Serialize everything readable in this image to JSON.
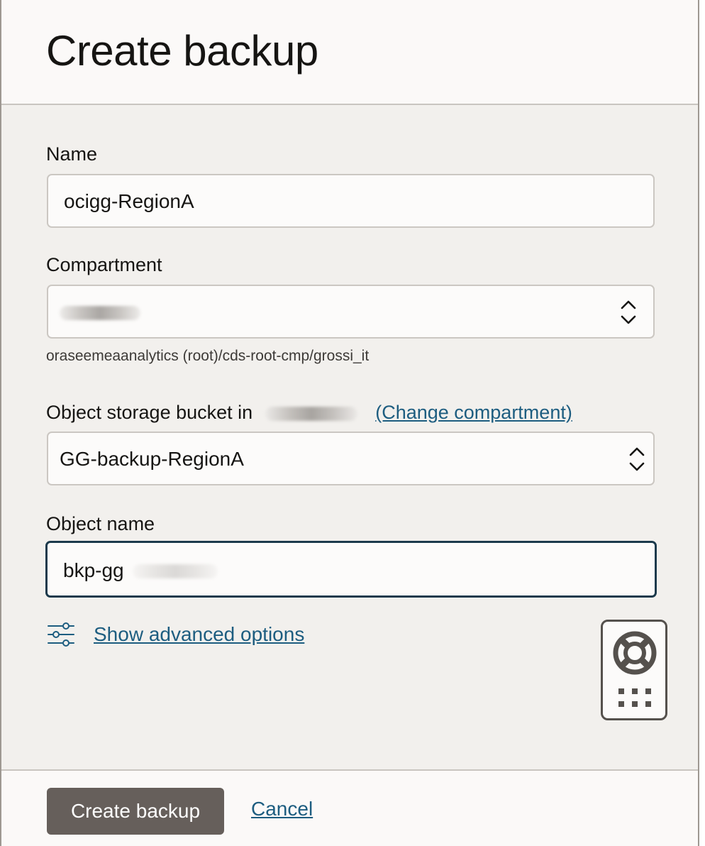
{
  "dialog": {
    "title": "Create backup"
  },
  "form": {
    "name": {
      "label": "Name",
      "value": "ocigg-RegionA"
    },
    "compartment": {
      "label": "Compartment",
      "path": "oraseemeaanalytics (root)/cds-root-cmp/grossi_it"
    },
    "bucket": {
      "label": "Object storage bucket in",
      "change_link": "(Change compartment)",
      "value": "GG-backup-RegionA"
    },
    "object_name": {
      "label": "Object name",
      "value": "bkp-gg"
    },
    "advanced_link": "Show advanced options"
  },
  "footer": {
    "create_label": "Create backup",
    "cancel_label": "Cancel"
  },
  "icons": {
    "select_chevrons": "chevron-up-down-icon",
    "advanced": "sliders-icon",
    "help": "lifebuoy-icon",
    "apps": "grid-dots-icon"
  },
  "colors": {
    "primary_button": "#665f5b",
    "link": "#1d5d80",
    "focus_border": "#1c3a4c",
    "body_background": "#f2f0ed"
  }
}
